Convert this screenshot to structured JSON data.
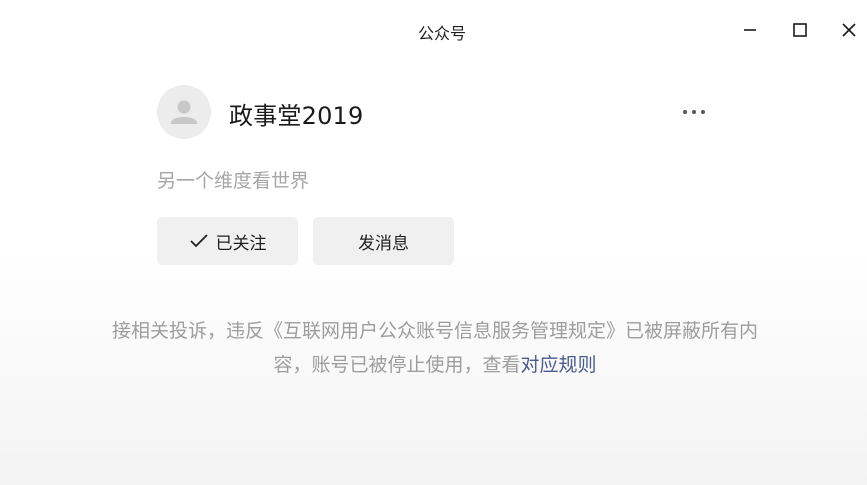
{
  "window": {
    "title": "公众号",
    "minimize_icon": "minimize-icon",
    "maximize_icon": "maximize-icon",
    "close_icon": "close-icon"
  },
  "account": {
    "avatar_icon": "default-avatar-icon",
    "name": "政事堂2019",
    "more_icon": "more-dots-icon",
    "description": "另一个维度看世界"
  },
  "actions": {
    "followed_label": "已关注",
    "followed_icon": "check-icon",
    "message_label": "发消息"
  },
  "notice": {
    "line1": "接相关投诉，违反《互联网用户公众账号信息服务管理规定》已被屏蔽所有内",
    "line2_prefix": "容，账号已被停止使用，查看",
    "link": "对应规则",
    "link_color": "#4a5d8c"
  }
}
